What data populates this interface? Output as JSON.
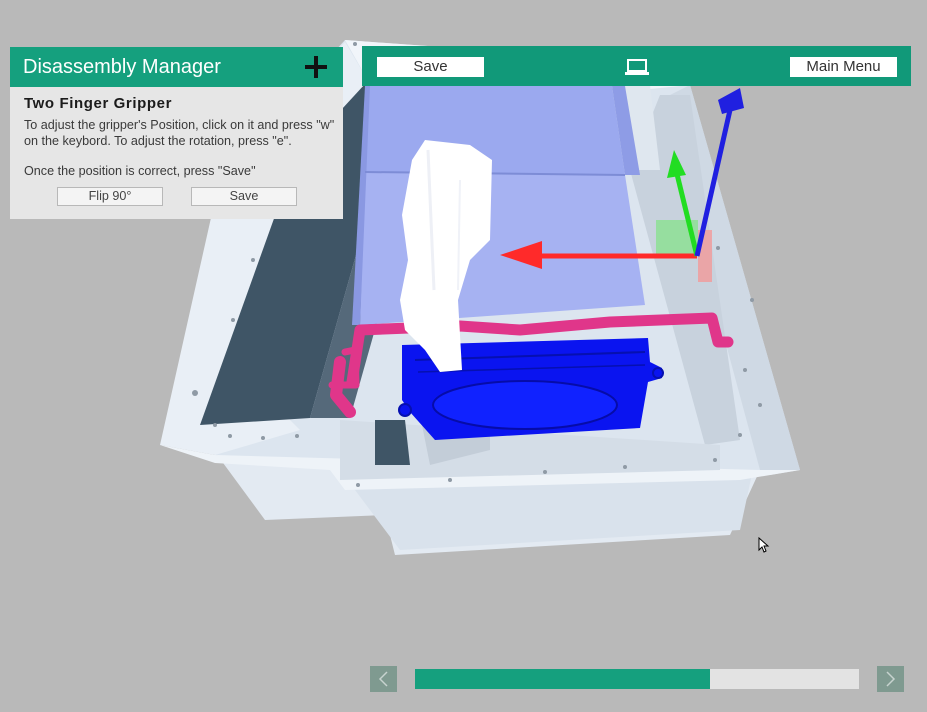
{
  "panel": {
    "title": "Disassembly Manager",
    "add_icon": "plus-icon",
    "tool_name": "Two Finger Gripper",
    "instruction_1": "To adjust the gripper's Position, click on it and press \"w\" on the keybord. To adjust the rotation, press \"e\".",
    "instruction_2": "Once the position is correct, press \"Save\"",
    "flip_label": "Flip 90°",
    "save_label": "Save"
  },
  "toolbar": {
    "save_label": "Save",
    "monitor_icon": "monitor-icon",
    "main_menu_label": "Main Menu"
  },
  "navigation": {
    "prev_icon": "chevron-left-icon",
    "next_icon": "chevron-right-icon",
    "progress": 0.665
  },
  "colors": {
    "accent": "#119979",
    "panel_background": "#e6e6e6",
    "viewport_background": "#b9b9b9",
    "axis_x": "#ff2a2a",
    "axis_y": "#22dd22",
    "axis_z": "#2020e0",
    "pipe": "#e0368a",
    "component_blue": "#0a14f0"
  }
}
